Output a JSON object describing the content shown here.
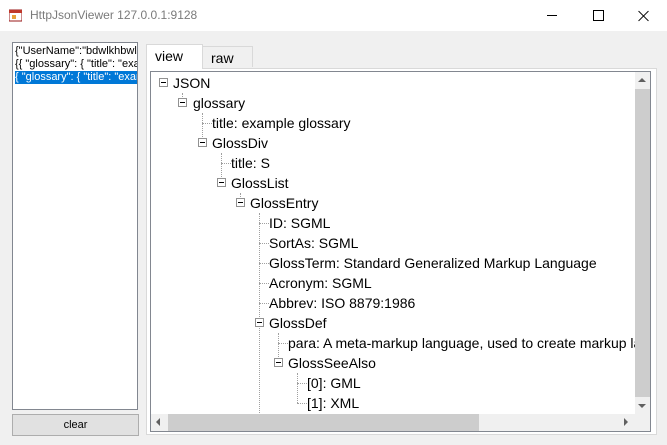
{
  "window": {
    "title": "HttpJsonViewer 127.0.0.1:9128",
    "icon": "app-icon",
    "accent_color": "#0078d7"
  },
  "requests": {
    "items": [
      {
        "label": "{\"UserName\":\"bdwlkhbwlkjhbfuhkbbwbwke\"}"
      },
      {
        "label": "{{ \"glossary\": { \"title\": \"example glossary\""
      },
      {
        "label": "{ \"glossary\": { \"title\": \"example glossary\""
      }
    ],
    "selected_index": 2,
    "clear_label": "clear"
  },
  "tabs": [
    {
      "label": "view",
      "active": true
    },
    {
      "label": "raw",
      "active": false
    }
  ],
  "tree": {
    "root": "JSON",
    "nodes": [
      {
        "text": "glossary"
      },
      {
        "text": "title: example glossary"
      },
      {
        "text": "GlossDiv"
      },
      {
        "text": "title: S"
      },
      {
        "text": "GlossList"
      },
      {
        "text": "GlossEntry"
      },
      {
        "text": "ID: SGML"
      },
      {
        "text": "SortAs: SGML"
      },
      {
        "text": "GlossTerm: Standard Generalized Markup Language"
      },
      {
        "text": "Acronym: SGML"
      },
      {
        "text": "Abbrev: ISO 8879:1986"
      },
      {
        "text": "GlossDef"
      },
      {
        "text": "para: A meta-markup language, used to create markup languages such as DocBook."
      },
      {
        "text": "GlossSeeAlso"
      },
      {
        "text": "[0]: GML"
      },
      {
        "text": "[1]: XML"
      }
    ]
  }
}
